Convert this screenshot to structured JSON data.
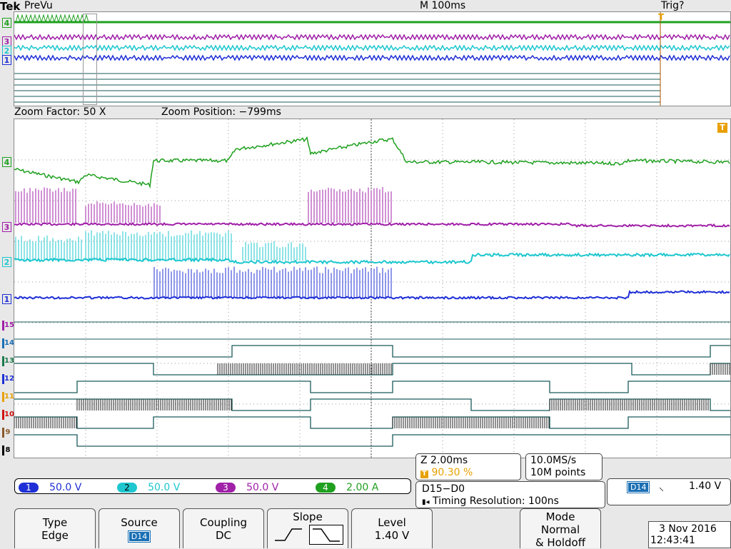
{
  "header": {
    "brand": "Tek",
    "mode": "PreVu",
    "timebase": "M 100ms",
    "trigger_status": "Trig?"
  },
  "zoom_bar": {
    "factor": "Zoom Factor: 50 X",
    "position": "Zoom Position: −799ms"
  },
  "overview_channels": [
    "4",
    "3",
    "2",
    "1"
  ],
  "main_channels": [
    "4",
    "3",
    "2",
    "1"
  ],
  "digital_channels": [
    "15",
    "14",
    "13",
    "12",
    "11",
    "10",
    "9",
    "8"
  ],
  "trigger_marker": "T",
  "channel_scales": [
    {
      "num": "1",
      "value": "50.0 V",
      "color": "#1f2fd6"
    },
    {
      "num": "2",
      "value": "50.0 V",
      "color": "#1ec7cf"
    },
    {
      "num": "3",
      "value": "50.0 V",
      "color": "#a020a8"
    },
    {
      "num": "4",
      "value": "2.00 A",
      "color": "#1fa01f"
    }
  ],
  "zoom_box": {
    "scale": "Z 2.00ms",
    "trigger_pos": "90.30 %"
  },
  "acq_box": {
    "rate": "10.0MS/s",
    "points": "10M points"
  },
  "digital_box": {
    "group": "D15−D0",
    "resolution": "Timing Resolution: 100ns"
  },
  "trigger_box": {
    "source": "D14",
    "slope_symbol": "⸜",
    "level": "1.40 V"
  },
  "buttons": {
    "type": {
      "top": "Type",
      "bottom": "Edge"
    },
    "source": {
      "top": "Source",
      "bottom": "D14"
    },
    "coupling": {
      "top": "Coupling",
      "bottom": "DC"
    },
    "slope": {
      "top": "Slope"
    },
    "level": {
      "top": "Level",
      "bottom": "1.40 V"
    },
    "mode": {
      "top": "Mode",
      "mid": "Normal",
      "bottom": "& Holdoff"
    }
  },
  "datetime": {
    "date": "3 Nov 2016",
    "time": "12:43:41"
  },
  "colors": {
    "ch1": "#1f2fd6",
    "ch2": "#1ec7cf",
    "ch3": "#a020a8",
    "ch4": "#1fa01f",
    "digital": "#1a5a5a",
    "trigger": "#e8a000"
  }
}
